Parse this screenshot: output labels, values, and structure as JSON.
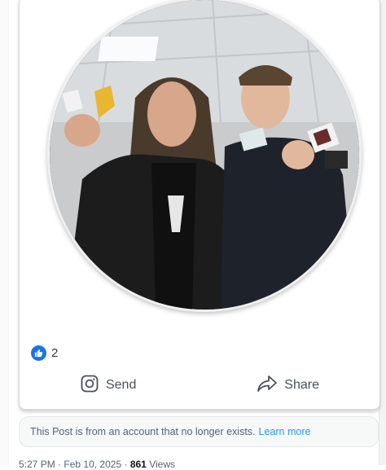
{
  "post": {
    "reaction_count": "2",
    "actions": {
      "send_label": "Send",
      "share_label": "Share"
    }
  },
  "notice": {
    "text": "This Post is from an account that no longer exists.",
    "link_label": "Learn more"
  },
  "meta": {
    "time": "5:27 PM",
    "separator": "·",
    "date": "Feb 10, 2025",
    "views_count": "861",
    "views_label": "Views"
  },
  "colors": {
    "like_blue": "#1b74e4",
    "link_blue": "#1d9bf0",
    "muted_text": "#536471"
  },
  "icons": {
    "like": "thumbs-up-icon",
    "send": "instagram-icon",
    "share": "share-arrow-icon"
  }
}
